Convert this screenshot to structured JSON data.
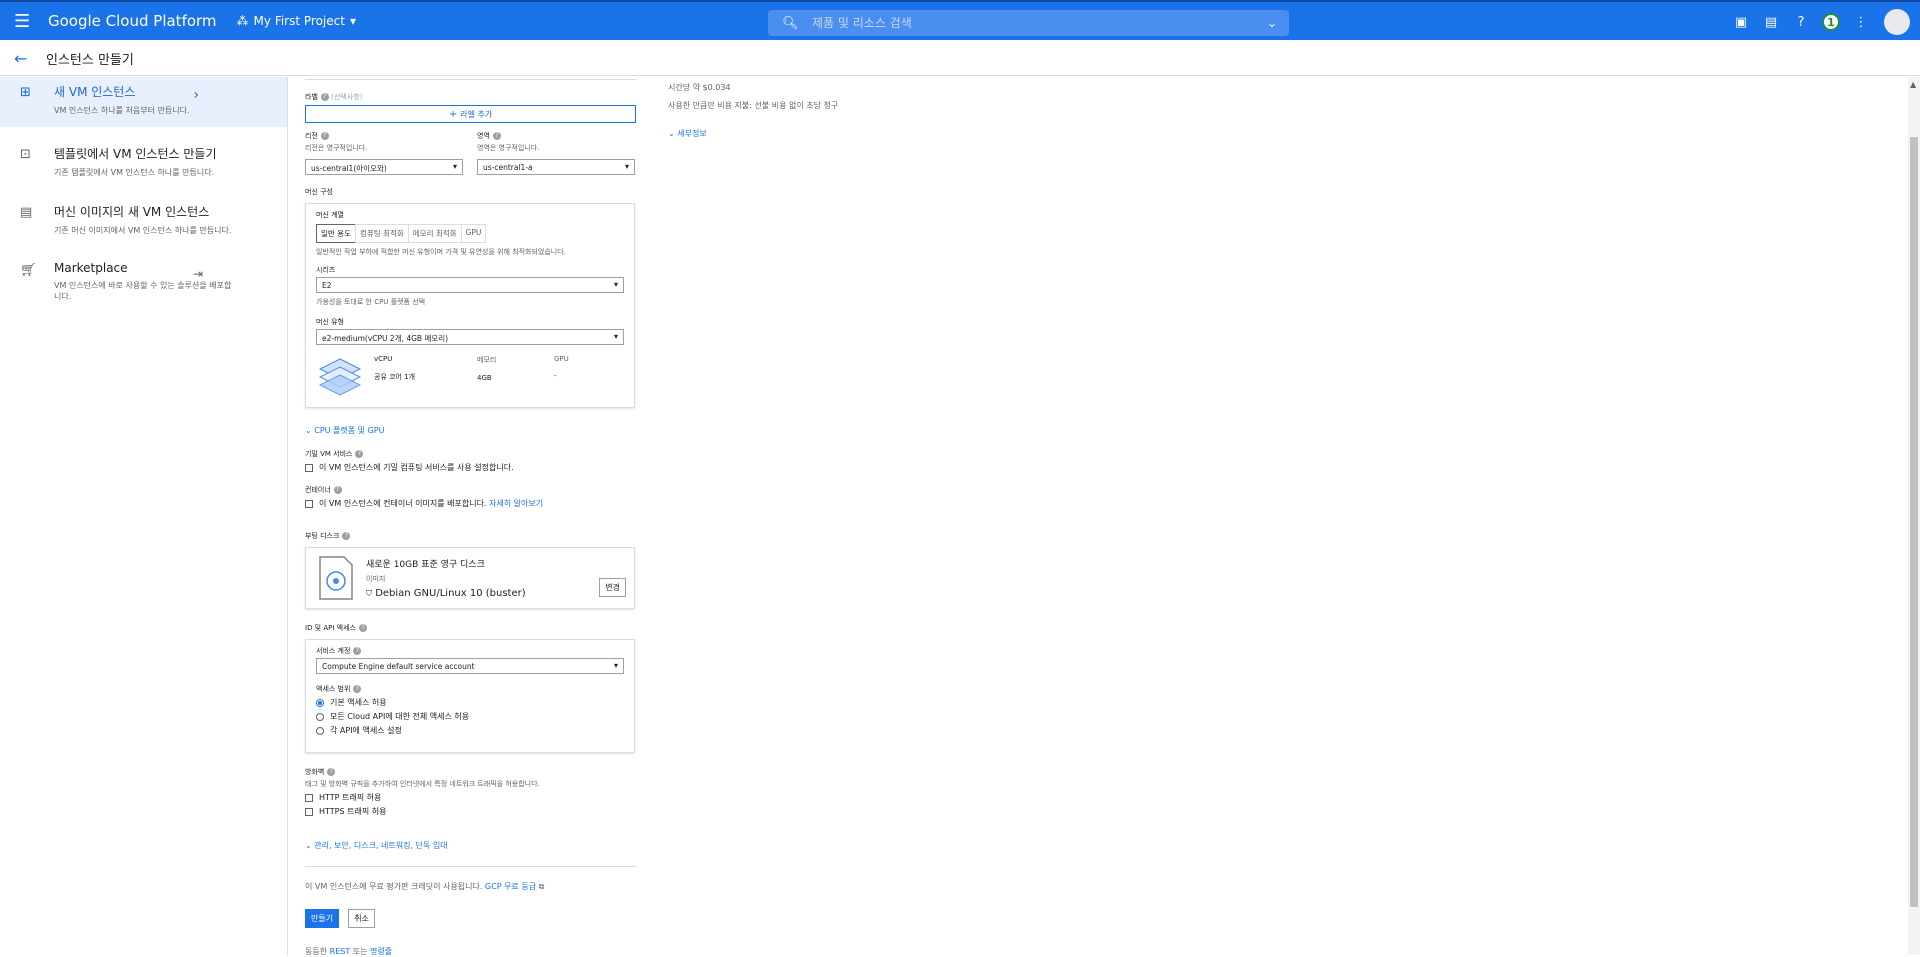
{
  "topbar": {
    "brand": "Google Cloud Platform",
    "project": "My First Project",
    "search_placeholder": "제품 및 리소스 검색",
    "badge": "1"
  },
  "subbar": {
    "title": "인스턴스 만들기"
  },
  "sidebar": {
    "items": [
      {
        "title": "새 VM 인스턴스",
        "desc": "VM 인스턴스 하나를 처음부터 만듭니다."
      },
      {
        "title": "템플릿에서 VM 인스턴스 만들기",
        "desc": "기존 템플릿에서 VM 인스턴스 하나를 만듭니다."
      },
      {
        "title": "머신 이미지의 새 VM 인스턴스",
        "desc": "기존 머신 이미지에서 VM 인스턴스 하나를 만듭니다."
      },
      {
        "title": "Marketplace",
        "desc": "VM 인스턴스에 바로 사용할 수 있는 솔루션을 배포합니다."
      }
    ]
  },
  "form": {
    "labels_label": "라벨",
    "optional": "(선택사항)",
    "add_label_btn": "라벨 추가",
    "region_label": "리전",
    "region_hint": "리전은 영구적입니다.",
    "region_value": "us-central1(아이오와)",
    "zone_label": "영역",
    "zone_hint": "영역은 영구적입니다.",
    "zone_value": "us-central1-a",
    "machine_config": "머신 구성",
    "machine_family": "머신 계열",
    "tabs": [
      "일반 용도",
      "컴퓨팅 최적화",
      "메모리 최적화",
      "GPU"
    ],
    "family_hint": "일반적인 작업 부하에 적합한 머신 유형이며 가격 및 유연성을 위해 최적화되었습니다.",
    "series_label": "시리즈",
    "series_value": "E2",
    "series_hint": "가용성을 토대로 한 CPU 플랫폼 선택",
    "machine_type_label": "머신 유형",
    "machine_type_value": "e2-medium(vCPU 2개, 4GB 메모리)",
    "spec": {
      "vcpu_h": "vCPU",
      "vcpu_v": "공유 코어 1개",
      "mem_h": "메모리",
      "mem_v": "4GB",
      "gpu_h": "GPU",
      "gpu_v": "-"
    },
    "cpu_link": "CPU 플랫폼 및 GPU",
    "confidential_label": "기밀 VM 서비스",
    "confidential_chk": "이 VM 인스턴스에 기밀 컴퓨팅 서비스를 사용 설정합니다.",
    "container_label": "컨테이너",
    "container_chk": "이 VM 인스턴스에 컨테이너 이미지를 배포합니다.",
    "container_link": "자세히 알아보기",
    "boot_disk_label": "부팅 디스크",
    "boot_disk_title": "새로운 10GB 표준 영구 디스크",
    "boot_disk_image_label": "이미지",
    "boot_disk_image": "Debian GNU/Linux 10 (buster)",
    "change_btn": "변경",
    "id_api_label": "ID 및 API 액세스",
    "service_account_label": "서비스 계정",
    "service_account_value": "Compute Engine default service account",
    "access_scope_label": "액세스 범위",
    "scope_options": [
      "기본 액세스 허용",
      "모든 Cloud API에 대한 전체 액세스 허용",
      "각 API에 액세스 설정"
    ],
    "firewall_label": "방화벽",
    "firewall_hint": "태그 및 방화벽 규칙을 추가하여 인터넷에서 특정 네트워크 트래픽을 허용합니다.",
    "http_chk": "HTTP 트래픽 허용",
    "https_chk": "HTTPS 트래픽 허용",
    "mgmt_link": "관리, 보안, 디스크, 네트워킹, 단독 임대",
    "free_trial_text": "이 VM 인스턴스에 무료 평가판 크레딧이 사용됩니다.",
    "free_trial_link": "GCP 무료 등급",
    "create_btn": "만들기",
    "cancel_btn": "취소",
    "equiv_prefix": "동등한",
    "rest_link": "REST",
    "or_text": "또는",
    "cmd_link": "명령줄"
  },
  "pricing": {
    "hourly": "시간당 약 $0.034",
    "billing_note": "사용한 만큼만 비용 지불: 선불 비용 없이 초당 청구",
    "details_link": "세부정보"
  }
}
